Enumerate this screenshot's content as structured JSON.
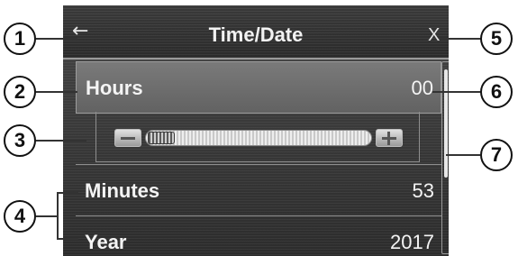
{
  "header": {
    "title": "Time/Date",
    "back_icon": "←",
    "close_label": "X"
  },
  "settings": [
    {
      "label": "Hours",
      "value": "00",
      "selected": true
    },
    {
      "label": "Minutes",
      "value": "53"
    },
    {
      "label": "Year",
      "value": "2017"
    }
  ],
  "slider": {
    "value_fraction": 0.0
  },
  "callouts": [
    "1",
    "2",
    "3",
    "4",
    "5",
    "6",
    "7"
  ],
  "colors": {
    "screen_bg": "#3b3b3b",
    "selected_row": "#6e6e6e",
    "text": "#f4f4f4",
    "callout_border": "#111111"
  }
}
